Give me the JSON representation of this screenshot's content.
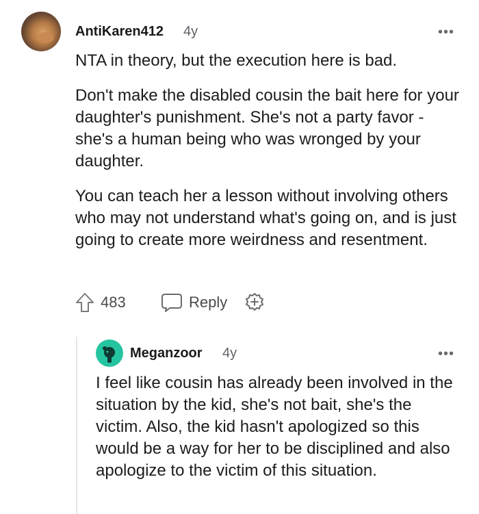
{
  "comment": {
    "username": "AntiKaren412",
    "age": "4y",
    "more": "•••",
    "paragraphs": [
      "NTA in theory, but the execution here is bad.",
      "Don't make the disabled cousin the bait here for your daughter's punishment. She's not a party favor - she's a human being who was wronged by your daughter.",
      "You can teach her a lesson without involving others who may not understand what's going on, and is just going to create more weirdness and resentment."
    ],
    "votes": "483",
    "reply_label": "Reply",
    "icons": {
      "upvote": "upvote-arrow-icon",
      "reply": "speech-bubble-icon",
      "award": "award-plus-icon",
      "more": "more-options-icon"
    }
  },
  "reply": {
    "username": "Meganzoor",
    "age": "4y",
    "more": "•••",
    "text": "I feel like cousin has already been involved in the situation by the kid, she's not bait, she's the victim. Also, the kid hasn't apologized so this would be a way for her to be disciplined and also apologize to the victim of this situation.",
    "avatar_color": "#25c4a0"
  },
  "colors": {
    "text": "#1c1c1c",
    "meta": "#5f6368",
    "icon": "#6b6b6b",
    "thread": "#e6e6e6"
  }
}
